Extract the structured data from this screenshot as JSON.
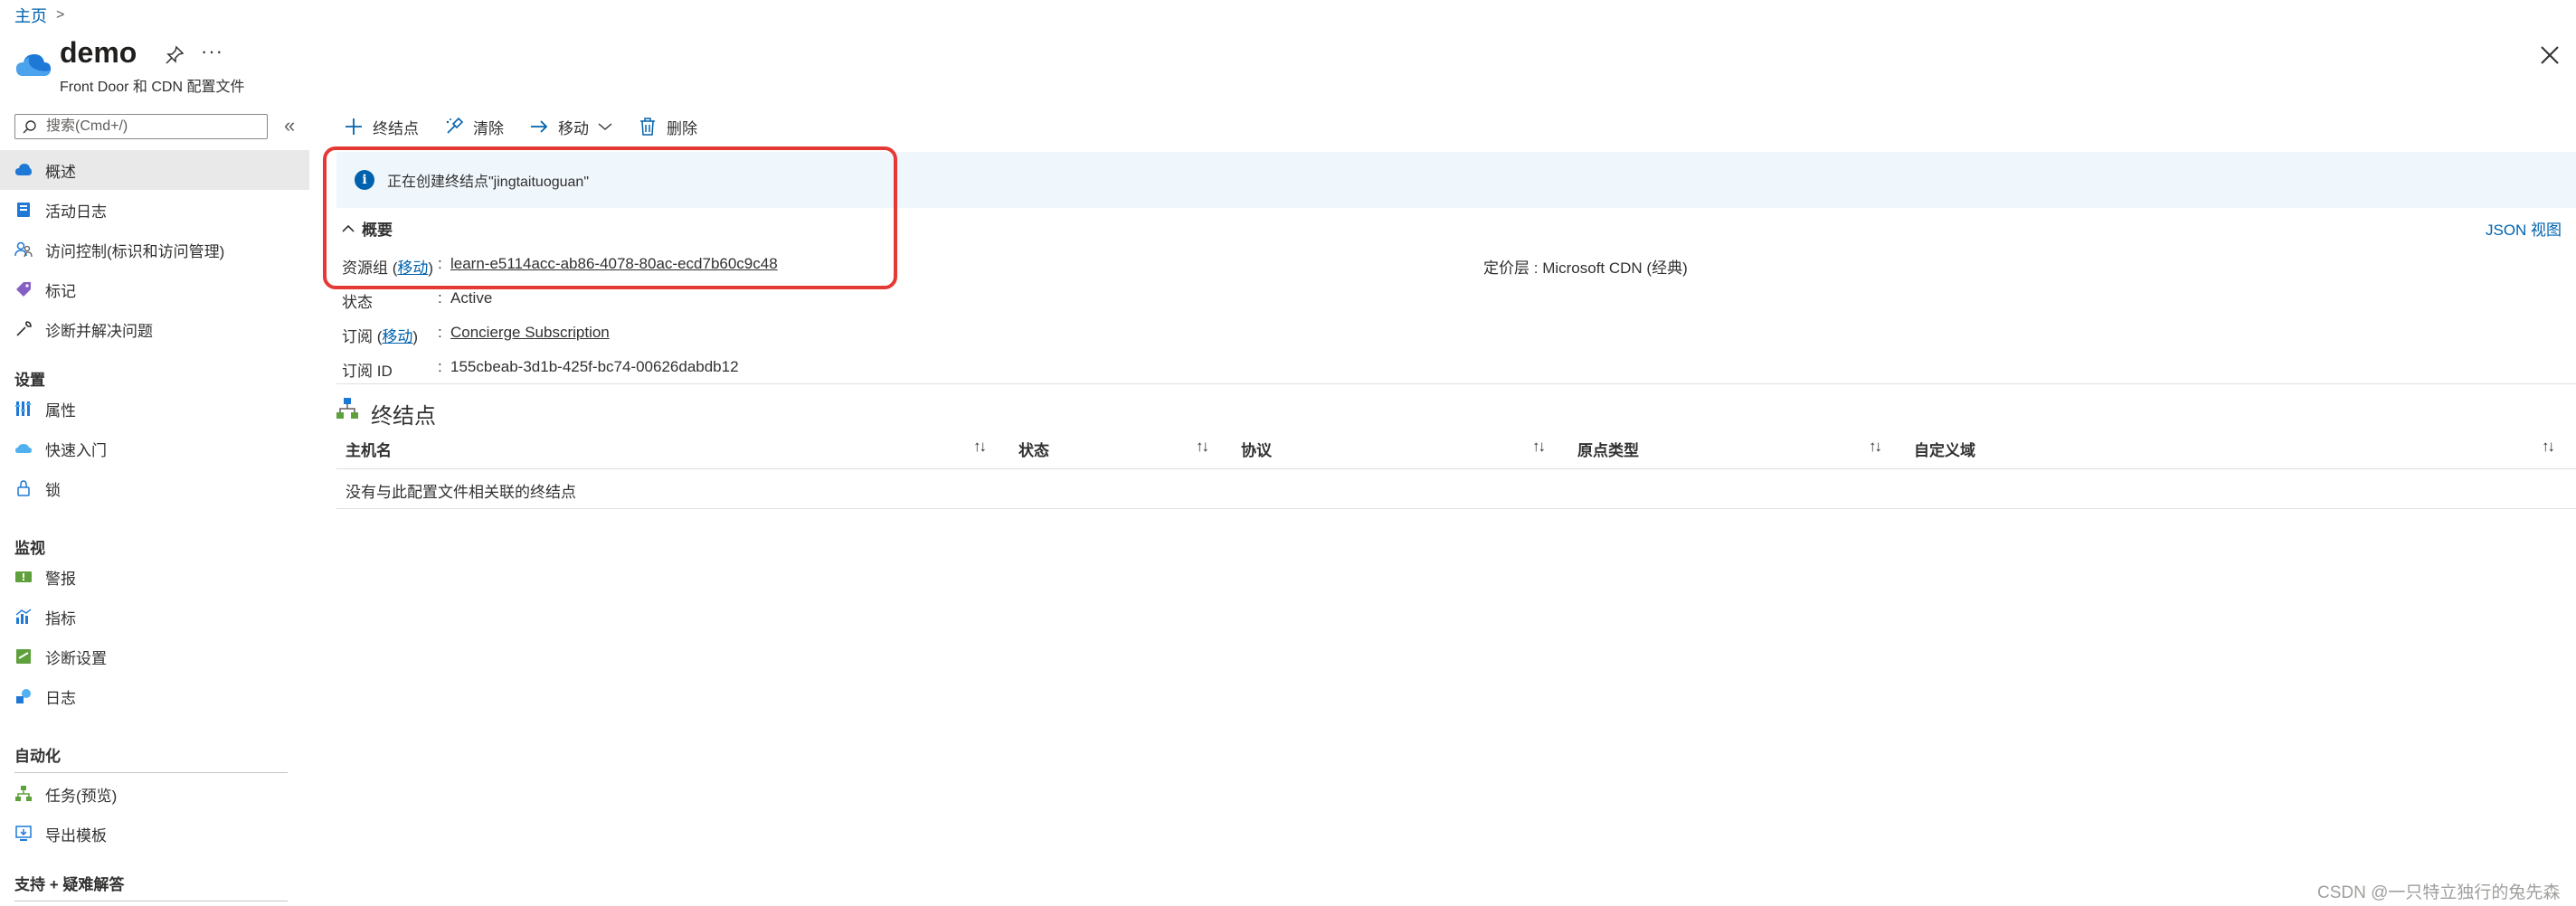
{
  "breadcrumb": {
    "home": "主页",
    "sep": ">"
  },
  "header": {
    "title": "demo",
    "subtitle": "Front Door 和 CDN 配置文件",
    "more": "···"
  },
  "sidebar": {
    "search_placeholder": "搜索(Cmd+/)",
    "collapse": "«",
    "items_top": [
      {
        "label": "概述",
        "icon": "cloud-icon"
      },
      {
        "label": "活动日志",
        "icon": "activity-log-icon"
      },
      {
        "label": "访问控制(标识和访问管理)",
        "icon": "people-icon"
      },
      {
        "label": "标记",
        "icon": "tag-icon"
      },
      {
        "label": "诊断并解决问题",
        "icon": "wrench-icon"
      }
    ],
    "groups": [
      {
        "title": "设置",
        "items": [
          {
            "label": "属性",
            "icon": "properties-icon"
          },
          {
            "label": "快速入门",
            "icon": "quickstart-icon"
          },
          {
            "label": "锁",
            "icon": "lock-icon"
          }
        ]
      },
      {
        "title": "监视",
        "items": [
          {
            "label": "警报",
            "icon": "alert-icon"
          },
          {
            "label": "指标",
            "icon": "metrics-icon"
          },
          {
            "label": "诊断设置",
            "icon": "diagnostic-settings-icon"
          },
          {
            "label": "日志",
            "icon": "logs-icon"
          }
        ]
      },
      {
        "title": "自动化",
        "items": [
          {
            "label": "任务(预览)",
            "icon": "tasks-icon"
          },
          {
            "label": "导出模板",
            "icon": "export-template-icon"
          }
        ]
      },
      {
        "title": "支持 + 疑难解答",
        "items": []
      }
    ]
  },
  "toolbar": {
    "add_endpoint": "终结点",
    "purge": "清除",
    "move": "移动",
    "delete": "删除"
  },
  "banner": {
    "text": "正在创建终结点\"jingtaituoguan\""
  },
  "essentials": {
    "title": "概要",
    "json_view": "JSON 视图",
    "resource_group_label": "资源组",
    "move_link": "移动",
    "resource_group_value": "learn-e5114acc-ab86-4078-80ac-ecd7b60c9c48",
    "status_label": "状态",
    "status_value": "Active",
    "subscription_label": "订阅",
    "subscription_value": "Concierge Subscription",
    "subscription_id_label": "订阅 ID",
    "subscription_id_value": "155cbeab-3d1b-425f-bc74-00626dabdb12",
    "pricing_tier_label": "定价层",
    "pricing_tier_value": "Microsoft CDN (经典)",
    "colon": ":"
  },
  "endpoints": {
    "title": "终结点",
    "columns": [
      "主机名",
      "状态",
      "协议",
      "原点类型",
      "自定义域"
    ],
    "sort_glyph": "↑↓",
    "empty_text": "没有与此配置文件相关联的终结点"
  },
  "watermark": "CSDN @一只特立独行的兔先森",
  "colors": {
    "accent": "#0062ad",
    "annotation": "#e53935",
    "banner": "#eff6fc"
  }
}
